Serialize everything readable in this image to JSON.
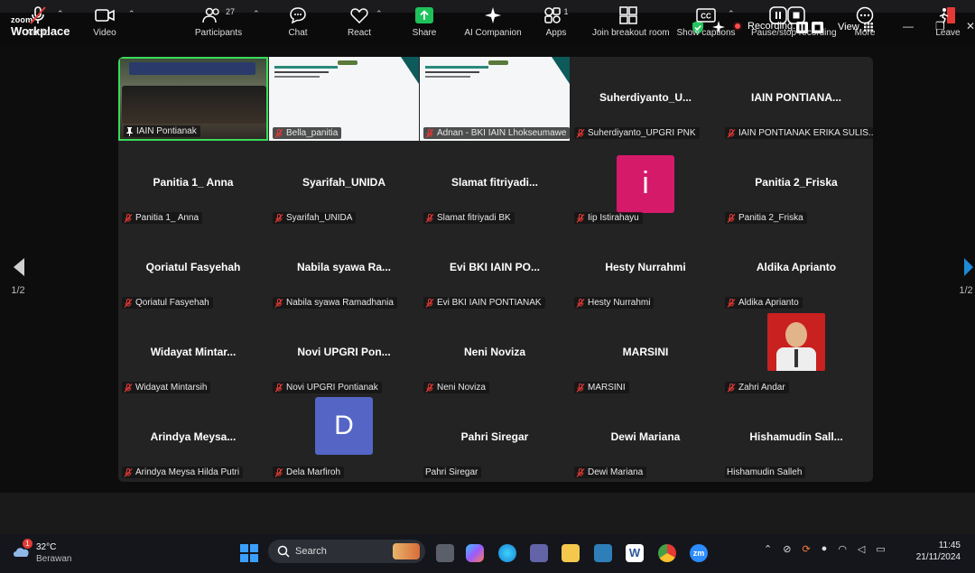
{
  "app": {
    "brand_small": "zoom",
    "brand_large": "Workplace"
  },
  "topbar": {
    "recording_label": "Recording...",
    "view_label": "View"
  },
  "page_indicator": {
    "left": "1/2",
    "right": "1/2"
  },
  "tiles": [
    {
      "title": "",
      "label": "IAIN Pontianak",
      "type": "video",
      "mic_off": false,
      "pinned": true
    },
    {
      "title": "",
      "label": "Bella_panitia",
      "type": "slide",
      "mic_off": true
    },
    {
      "title": "",
      "label": "Adnan - BKI IAIN Lhokseumawe",
      "type": "slide",
      "mic_off": true
    },
    {
      "title": "Suherdiyanto_U...",
      "label": "Suherdiyanto_UPGRI PNK",
      "type": "name",
      "mic_off": true
    },
    {
      "title": "IAIN PONTIANA...",
      "label": "IAIN PONTIANAK ERIKA SULIS...",
      "type": "name",
      "mic_off": true
    },
    {
      "title": "Panitia 1_ Anna",
      "label": "Panitia 1_ Anna",
      "type": "name",
      "mic_off": true
    },
    {
      "title": "Syarifah_UNIDA",
      "label": "Syarifah_UNIDA",
      "type": "name",
      "mic_off": true
    },
    {
      "title": "Slamat  fitriyadi...",
      "label": "Slamat fitriyadi BK",
      "type": "name",
      "mic_off": true
    },
    {
      "title": "",
      "label": "Iip Istirahayu",
      "type": "avatar",
      "avatar_letter": "i",
      "mic_off": true
    },
    {
      "title": "Panitia 2_Friska",
      "label": "Panitia 2_Friska",
      "type": "name",
      "mic_off": true
    },
    {
      "title": "Qoriatul Fasyehah",
      "label": "Qoriatul Fasyehah",
      "type": "name",
      "mic_off": true
    },
    {
      "title": "Nabila syawa  Ra...",
      "label": "Nabila syawa Ramadhania",
      "type": "name",
      "mic_off": true
    },
    {
      "title": "Evi BKI IAIN PO...",
      "label": "Evi BKI IAIN PONTIANAK",
      "type": "name",
      "mic_off": true
    },
    {
      "title": "Hesty Nurrahmi",
      "label": "Hesty Nurrahmi",
      "type": "name",
      "mic_off": true
    },
    {
      "title": "Aldika Aprianto",
      "label": "Aldika Aprianto",
      "type": "name",
      "mic_off": true
    },
    {
      "title": "Widayat  Mintar...",
      "label": "Widayat Mintarsih",
      "type": "name",
      "mic_off": true
    },
    {
      "title": "Novi UPGRI  Pon...",
      "label": "Novi UPGRI Pontianak",
      "type": "name",
      "mic_off": true
    },
    {
      "title": "Neni Noviza",
      "label": "Neni Noviza",
      "type": "name",
      "mic_off": true
    },
    {
      "title": "MARSINI",
      "label": "MARSINI",
      "type": "name",
      "mic_off": true
    },
    {
      "title": "",
      "label": "Zahri Andar",
      "type": "photo",
      "mic_off": true
    },
    {
      "title": "Arindya  Meysa...",
      "label": "Arindya Meysa Hilda Putri",
      "type": "name",
      "mic_off": true
    },
    {
      "title": "",
      "label": "Dela Marfiroh",
      "type": "avatar2",
      "avatar_letter": "D",
      "mic_off": true
    },
    {
      "title": "Pahri Siregar",
      "label": "Pahri Siregar",
      "type": "name",
      "mic_off": false
    },
    {
      "title": "Dewi Mariana",
      "label": "Dewi Mariana",
      "type": "name",
      "mic_off": true
    },
    {
      "title": "Hishamudin  Sall...",
      "label": "Hishamudin Salleh",
      "type": "name",
      "mic_off": false
    }
  ],
  "toolbar": {
    "audio": "Audio",
    "video": "Video",
    "participants": "Participants",
    "participants_count": "27",
    "chat": "Chat",
    "react": "React",
    "share": "Share",
    "ai": "AI Companion",
    "apps": "Apps",
    "apps_count": "1",
    "breakout": "Join breakout room",
    "captions": "Show captions",
    "record": "Pause/stop recording",
    "more": "More",
    "leave": "Leave"
  },
  "taskbar": {
    "weather_temp": "32°C",
    "weather_desc": "Berawan",
    "weather_badge": "1",
    "search_placeholder": "Search",
    "time": "11:45",
    "date": "21/11/2024"
  },
  "colors": {
    "accent_green": "#3adb5a",
    "share_green": "#1ec15a",
    "avatar_pink": "#d61a6a",
    "avatar_blue": "#5465c6",
    "mic_red": "#e53935"
  }
}
